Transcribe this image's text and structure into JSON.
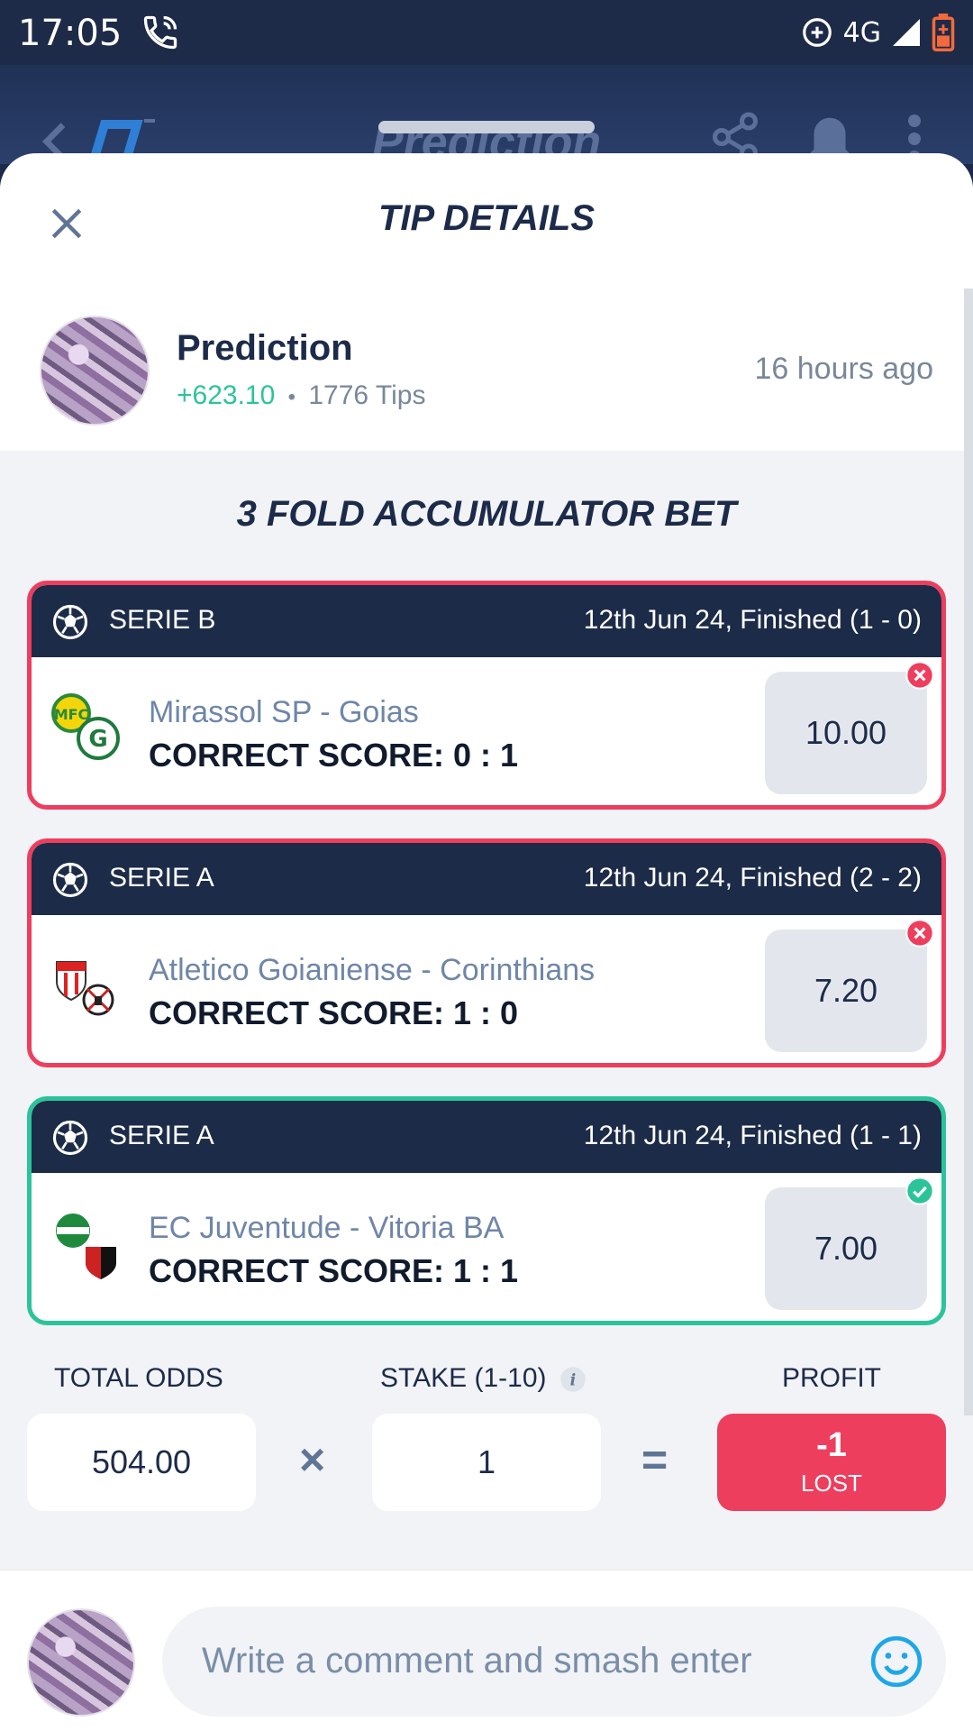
{
  "status_bar": {
    "time": "17:05",
    "network": "4G"
  },
  "app_header": {
    "title": "Prediction"
  },
  "sheet": {
    "title": "TIP DETAILS"
  },
  "tipster": {
    "name": "Prediction",
    "profit": "+623.10",
    "separator": "•",
    "tips": "1776 Tips",
    "time_ago": "16 hours ago"
  },
  "bet": {
    "title": "3 FOLD ACCUMULATOR BET",
    "tips": [
      {
        "league": "SERIE B",
        "status": "12th Jun 24, Finished (1 - 0)",
        "match": "Mirassol SP - Goias",
        "pick": "CORRECT SCORE: 0 : 1",
        "odds": "10.00",
        "result": "lost"
      },
      {
        "league": "SERIE A",
        "status": "12th Jun 24, Finished (2 - 2)",
        "match": "Atletico Goianiense - Corinthians",
        "pick": "CORRECT SCORE: 1 : 0",
        "odds": "7.20",
        "result": "lost"
      },
      {
        "league": "SERIE A",
        "status": "12th Jun 24, Finished (1 - 1)",
        "match": "EC Juventude - Vitoria BA",
        "pick": "CORRECT SCORE: 1 : 1",
        "odds": "7.00",
        "result": "won"
      }
    ]
  },
  "summary": {
    "total_odds_label": "TOTAL ODDS",
    "total_odds": "504.00",
    "multiply": "×",
    "stake_label": "STAKE (1-10)",
    "stake": "1",
    "equals": "=",
    "profit_label": "PROFIT",
    "profit": "-1",
    "profit_status": "LOST"
  },
  "comment": {
    "placeholder": "Write a comment and smash enter"
  },
  "colors": {
    "lost": "#ee3e5e",
    "won": "#2bc49a",
    "navy": "#1c2b48",
    "profit_green": "#2bc49a"
  },
  "icons": {
    "close": "close-icon",
    "ball": "soccer-ball-icon",
    "lost_badge": "x-circle-icon",
    "won_badge": "check-circle-icon",
    "info": "info-icon",
    "emoji": "smiley-icon"
  }
}
